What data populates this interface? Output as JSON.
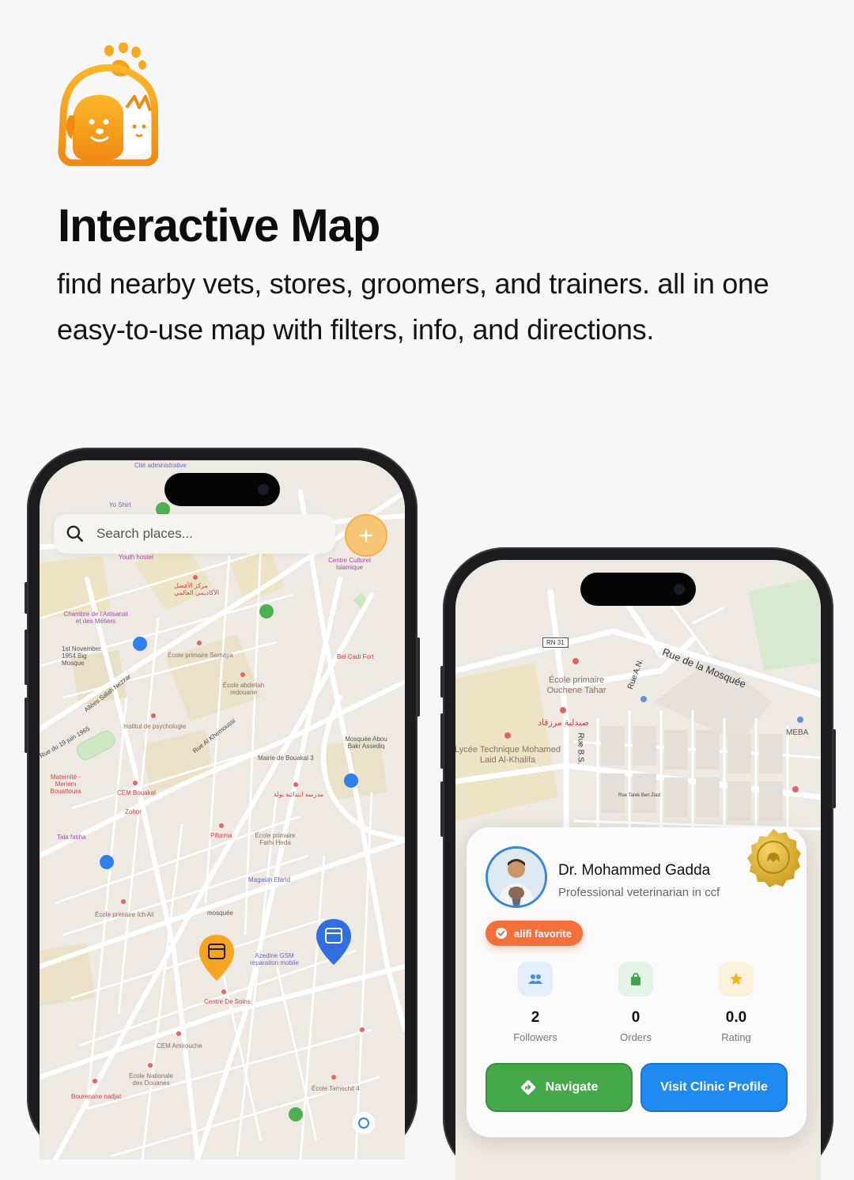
{
  "headline": "Interactive Map",
  "subheadline": "find nearby vets, stores, groomers, and trainers. all in one easy-to-use map with filters, info, and directions.",
  "colors": {
    "brand_orange": "#f5a020",
    "navigate_green": "#45a94a",
    "visit_blue": "#1f8bf0",
    "favorite_orange": "#f3703b"
  },
  "phone_left": {
    "search": {
      "placeholder": "Search places..."
    },
    "add_icon": "plus-icon",
    "map_labels": {
      "youth_hostel": "Youth hostel",
      "chambre": "Chambre de l'Artisanat et des Métiers",
      "big_mosque": "1st November 1954 Big Mosque",
      "ecole_semaya": "École primaire Semaya",
      "abdellah": "École abdellah redouane",
      "psychologie": "Institut de psychologie",
      "allees": "Allées Salah Nezzar",
      "juin": "Rue du 19 juin 1965",
      "maternite": "Maternité - Meriem Bouattoura",
      "khemoussi": "Rue Al Khemoussi",
      "bouakal3": "Mairie de Bouakal 3",
      "abou_bakr": "Mosquée Abou Bakr Assediq",
      "cem_bouakal": "CEM Bouakal",
      "zohor": "Zohor",
      "tala": "Tala fatiha",
      "piforma": "Piforma",
      "farhi": "École primaire Farhi Heda",
      "magasin": "Magasin Elarid",
      "ich_ali": "École primaire Ich Ali",
      "mosquee": "mosquée",
      "centre_soins": "Centre De Soins",
      "azedine": "Azedine GSM reparation mobile",
      "cem_amirouche": "CEM Amirouche",
      "douanes": "École Nationale des Douanes",
      "bourenane": "Bourenane nadjat",
      "tamechit": "École Tamechit 4",
      "centre_culturel": "Centre Culturel Islamique",
      "bel_cadi": "Bel Cadi Fort",
      "cite_admin": "Cité administrative",
      "yo_shirt": "Yo Shirt",
      "arabic_center": "مركز الأفضل الأكاديمي العالمي",
      "arabic_school": "مدرسة ابتدائية بولة"
    }
  },
  "phone_right": {
    "map_labels": {
      "rn31": "RN 31",
      "mosquee_rue": "Rue de la Mosquée",
      "ecole_ouchene": "École primaire Ouchene Tahar",
      "lycee": "Lycée Technique Mohamed Laid Al-Khalifa",
      "pharmacy_ar": "صيدلية مرزقاد",
      "rue_an": "Rue A.N.",
      "rue_bs": "Rue B.S.",
      "meba": "MEBA",
      "tarek": "Rue Tarek Ben Ziad"
    },
    "card": {
      "name": "Dr. Mohammed Gadda",
      "description": "Professional veterinarian in ccf",
      "badge": "alifi favorite",
      "stats": [
        {
          "icon": "people-icon",
          "value": "2",
          "label": "Followers"
        },
        {
          "icon": "shopping-bag-icon",
          "value": "0",
          "label": "Orders"
        },
        {
          "icon": "star-icon",
          "value": "0.0",
          "label": "Rating"
        }
      ],
      "navigate_label": "Navigate",
      "visit_label": "Visit Clinic Profile"
    }
  }
}
